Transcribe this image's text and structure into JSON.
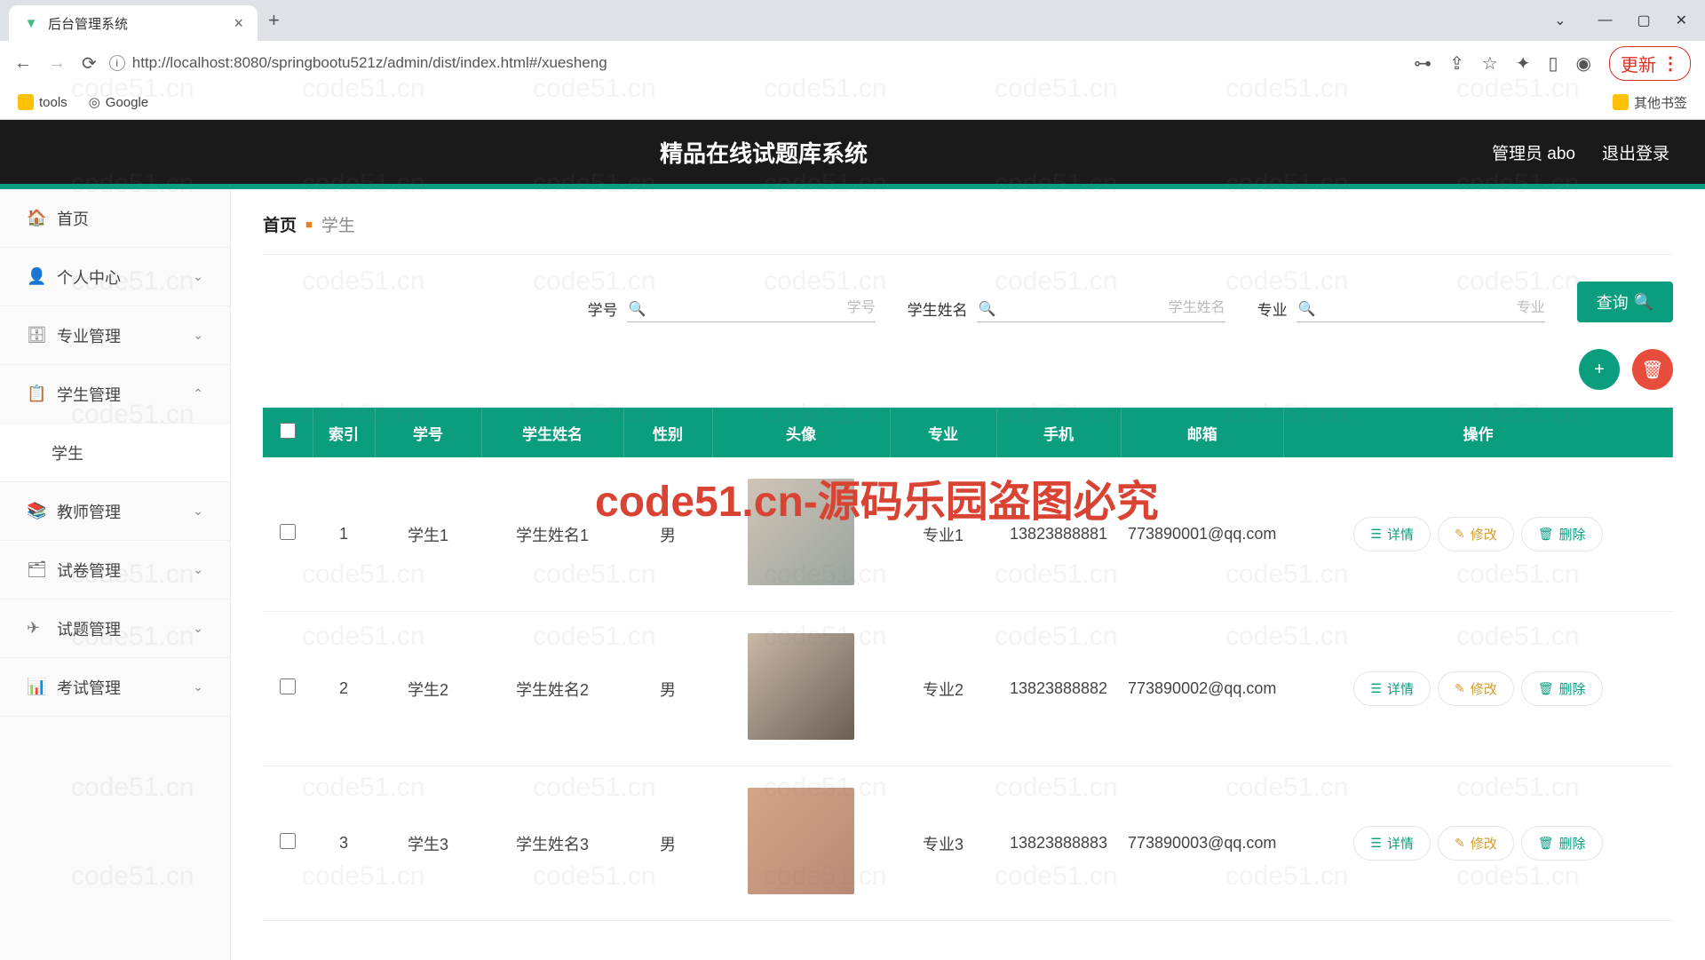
{
  "browser": {
    "tab_title": "后台管理系统",
    "url": "http://localhost:8080/springbootu521z/admin/dist/index.html#/xuesheng",
    "update_label": "更新",
    "bookmarks": {
      "tools": "tools",
      "google": "Google",
      "other": "其他书签"
    }
  },
  "header": {
    "system_title": "精品在线试题库系统",
    "admin_label": "管理员 abo",
    "logout_label": "退出登录"
  },
  "sidebar": {
    "items": [
      {
        "icon": "🏠",
        "label": "首页",
        "expandable": false
      },
      {
        "icon": "👤",
        "label": "个人中心",
        "expandable": true,
        "expanded": false
      },
      {
        "icon": "🗄",
        "label": "专业管理",
        "expandable": true,
        "expanded": false
      },
      {
        "icon": "📋",
        "label": "学生管理",
        "expandable": true,
        "expanded": true
      },
      {
        "icon": "",
        "label": "学生",
        "sub": true
      },
      {
        "icon": "📚",
        "label": "教师管理",
        "expandable": true,
        "expanded": false
      },
      {
        "icon": "🗂",
        "label": "试卷管理",
        "expandable": true,
        "expanded": false
      },
      {
        "icon": "✈",
        "label": "试题管理",
        "expandable": true,
        "expanded": false
      },
      {
        "icon": "📊",
        "label": "考试管理",
        "expandable": true,
        "expanded": false
      }
    ]
  },
  "breadcrumb": {
    "home": "首页",
    "current": "学生"
  },
  "search": {
    "field1_label": "学号",
    "field1_placeholder": "学号",
    "field2_label": "学生姓名",
    "field2_placeholder": "学生姓名",
    "field3_label": "专业",
    "field3_placeholder": "专业",
    "query_label": "查询"
  },
  "table": {
    "headers": [
      "",
      "索引",
      "学号",
      "学生姓名",
      "性别",
      "头像",
      "专业",
      "手机",
      "邮箱",
      "操作"
    ],
    "rows": [
      {
        "idx": "1",
        "sid": "学生1",
        "name": "学生姓名1",
        "gender": "男",
        "major": "专业1",
        "phone": "13823888881",
        "email": "773890001@qq.com"
      },
      {
        "idx": "2",
        "sid": "学生2",
        "name": "学生姓名2",
        "gender": "男",
        "major": "专业2",
        "phone": "13823888882",
        "email": "773890002@qq.com"
      },
      {
        "idx": "3",
        "sid": "学生3",
        "name": "学生姓名3",
        "gender": "男",
        "major": "专业3",
        "phone": "13823888883",
        "email": "773890003@qq.com"
      }
    ],
    "actions": {
      "detail": "详情",
      "modify": "修改",
      "delete": "删除"
    }
  },
  "watermark": {
    "main": "code51.cn-源码乐园盗图必究",
    "bg": "code51.cn"
  }
}
